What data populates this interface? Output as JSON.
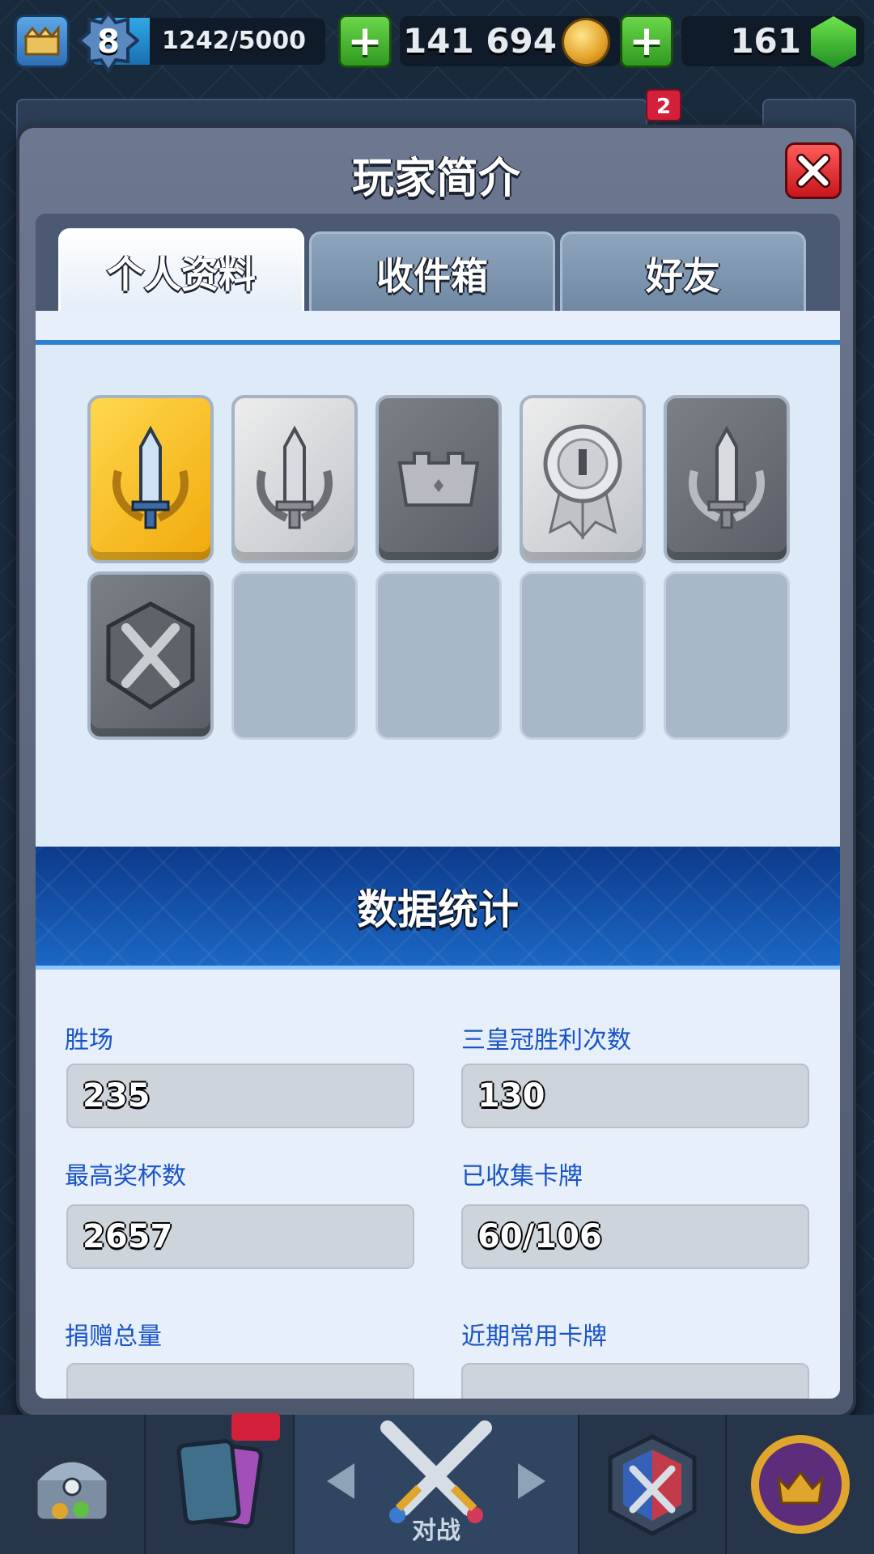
{
  "topbar": {
    "level": "8",
    "xp": "1242/5000",
    "xp_progress": 0.25,
    "gold": "141 694",
    "gems": "161"
  },
  "behind": {
    "notification_count": "2"
  },
  "modal": {
    "title": "玩家简介",
    "tabs": [
      "个人资料",
      "收件箱",
      "好友"
    ],
    "active_tab": 0,
    "badges": [
      {
        "name": "gold-sword-laurel-badge",
        "style": "gold"
      },
      {
        "name": "silver-sword-laurel-badge",
        "style": "silver"
      },
      {
        "name": "crown-badge",
        "style": "dark"
      },
      {
        "name": "medal-ribbon-badge",
        "style": "silver"
      },
      {
        "name": "sword-laurel-badge",
        "style": "dark"
      },
      {
        "name": "crossed-swords-shield-badge",
        "style": "dark"
      }
    ],
    "empty_badge_slots": 4,
    "stats_title": "数据统计",
    "stats": [
      {
        "label": "胜场",
        "value": "235"
      },
      {
        "label": "三皇冠胜利次数",
        "value": "130"
      },
      {
        "label": "最高奖杯数",
        "value": "2657"
      },
      {
        "label": "已收集卡牌",
        "value": "60/106"
      },
      {
        "label": "捐赠总量",
        "value": ""
      },
      {
        "label": "近期常用卡牌",
        "value": ""
      }
    ]
  },
  "bottom_nav": {
    "battle_label": "对战"
  },
  "colors": {
    "stat_label": "#1a54c8",
    "banner": "#1b67c4",
    "close_button": "#e02b2f",
    "plus_button": "#3fb52b"
  }
}
